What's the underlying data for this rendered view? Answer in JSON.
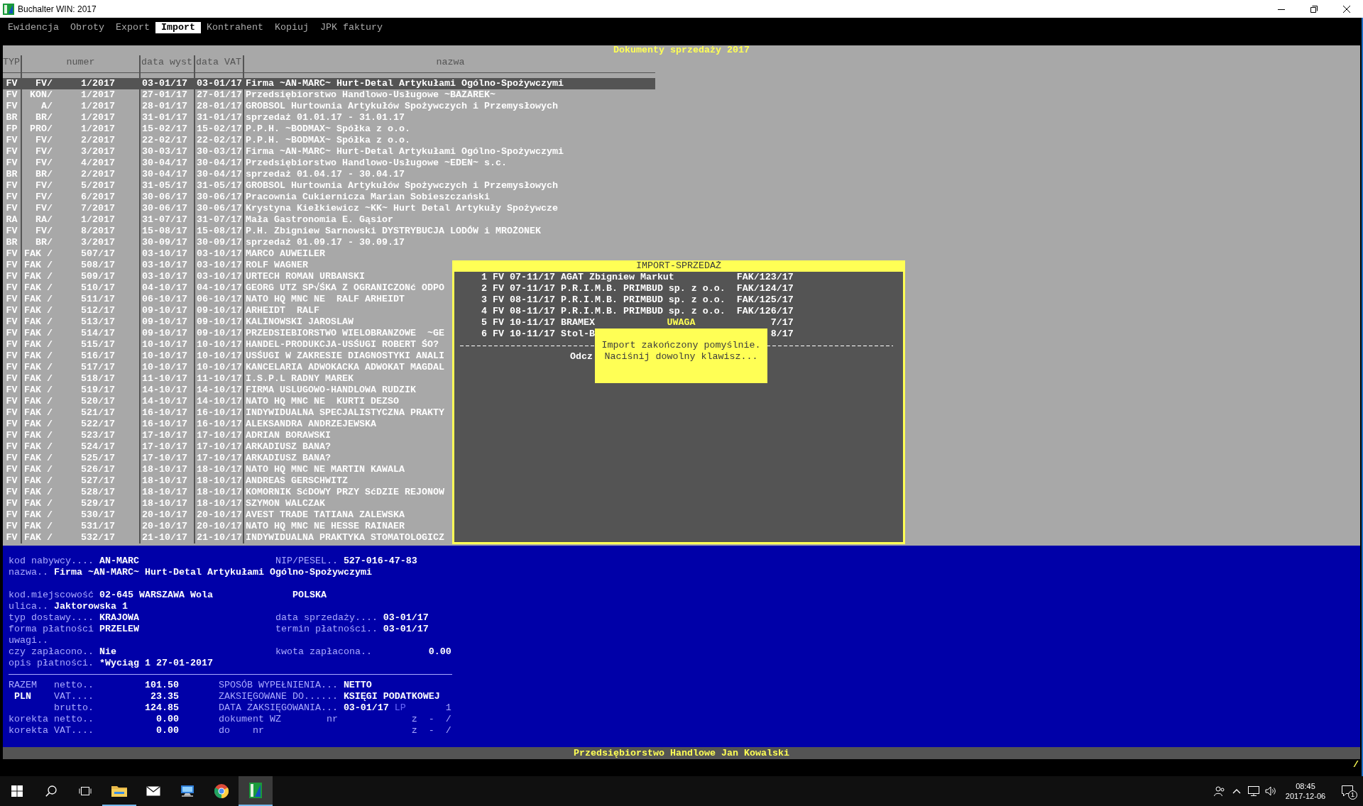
{
  "window": {
    "title": "Buchalter WIN: 2017"
  },
  "menu": [
    {
      "label": "Ewidencja",
      "selected": false
    },
    {
      "label": "Obroty",
      "selected": false
    },
    {
      "label": "Export",
      "selected": false
    },
    {
      "label": "Import",
      "selected": true
    },
    {
      "label": "Kontrahent",
      "selected": false
    },
    {
      "label": "Kopiuj",
      "selected": false
    },
    {
      "label": "JPK faktury",
      "selected": false
    }
  ],
  "list_title": "Dokumenty sprzedaży 2017",
  "table": {
    "columns": [
      "TYP",
      "numer",
      "data wyst",
      "data VAT",
      "nazwa"
    ],
    "rows": [
      {
        "typ": "FV",
        "series": "FV/",
        "number": "1/2017",
        "issued": "03-01/17",
        "vat_date": "03-01/17",
        "name": "Firma ~AN-MARC~ Hurt-Detal Artykułami Ogólno-Spożywczymi",
        "selected": true
      },
      {
        "typ": "FV",
        "series": "KON/",
        "number": "1/2017",
        "issued": "27-01/17",
        "vat_date": "27-01/17",
        "name": "Przedsiębiorstwo Handlowo-Usługowe ~BAZAREK~",
        "selected": false
      },
      {
        "typ": "FV",
        "series": "A/",
        "number": "1/2017",
        "issued": "28-01/17",
        "vat_date": "28-01/17",
        "name": "GROBSOL Hurtownia Artykułów Spożywczych i Przemysłowych",
        "selected": false
      },
      {
        "typ": "BR",
        "series": "BR/",
        "number": "1/2017",
        "issued": "31-01/17",
        "vat_date": "31-01/17",
        "name": "sprzedaż 01.01.17 - 31.01.17",
        "selected": false
      },
      {
        "typ": "FP",
        "series": "PRO/",
        "number": "1/2017",
        "issued": "15-02/17",
        "vat_date": "15-02/17",
        "name": "P.P.H. ~BODMAX~ Spółka z o.o.",
        "selected": false
      },
      {
        "typ": "FV",
        "series": "FV/",
        "number": "2/2017",
        "issued": "22-02/17",
        "vat_date": "22-02/17",
        "name": "P.P.H. ~BODMAX~ Spółka z o.o.",
        "selected": false
      },
      {
        "typ": "FV",
        "series": "FV/",
        "number": "3/2017",
        "issued": "30-03/17",
        "vat_date": "30-03/17",
        "name": "Firma ~AN-MARC~ Hurt-Detal Artykułami Ogólno-Spożywczymi",
        "selected": false
      },
      {
        "typ": "FV",
        "series": "FV/",
        "number": "4/2017",
        "issued": "30-04/17",
        "vat_date": "30-04/17",
        "name": "Przedsiębiorstwo Handlowo-Usługowe ~EDEN~ s.c.",
        "selected": false
      },
      {
        "typ": "BR",
        "series": "BR/",
        "number": "2/2017",
        "issued": "30-04/17",
        "vat_date": "30-04/17",
        "name": "sprzedaż 01.04.17 - 30.04.17",
        "selected": false
      },
      {
        "typ": "FV",
        "series": "FV/",
        "number": "5/2017",
        "issued": "31-05/17",
        "vat_date": "31-05/17",
        "name": "GROBSOL Hurtownia Artykułów Spożywczych i Przemysłowych",
        "selected": false
      },
      {
        "typ": "FV",
        "series": "FV/",
        "number": "6/2017",
        "issued": "30-06/17",
        "vat_date": "30-06/17",
        "name": "Pracownia Cukiernicza Marian Sobieszczański",
        "selected": false
      },
      {
        "typ": "FV",
        "series": "FV/",
        "number": "7/2017",
        "issued": "30-06/17",
        "vat_date": "30-06/17",
        "name": "Krystyna Kiełkiewicz ~KK~ Hurt Detal Artykuły Spożywcze",
        "selected": false
      },
      {
        "typ": "RA",
        "series": "RA/",
        "number": "1/2017",
        "issued": "31-07/17",
        "vat_date": "31-07/17",
        "name": "Mała Gastronomia E. Gąsior",
        "selected": false
      },
      {
        "typ": "FV",
        "series": "FV/",
        "number": "8/2017",
        "issued": "15-08/17",
        "vat_date": "15-08/17",
        "name": "P.H. Zbigniew Sarnowski DYSTRYBUCJA LODÓW i MROŻONEK",
        "selected": false
      },
      {
        "typ": "BR",
        "series": "BR/",
        "number": "3/2017",
        "issued": "30-09/17",
        "vat_date": "30-09/17",
        "name": "sprzedaż 01.09.17 - 30.09.17",
        "selected": false
      },
      {
        "typ": "FV",
        "series": "FAK /",
        "number": "507/17",
        "issued": "03-10/17",
        "vat_date": "03-10/17",
        "name": "MARCO AUWEILER",
        "selected": false
      },
      {
        "typ": "FV",
        "series": "FAK /",
        "number": "508/17",
        "issued": "03-10/17",
        "vat_date": "03-10/17",
        "name": "ROLF WAGNER",
        "selected": false
      },
      {
        "typ": "FV",
        "series": "FAK /",
        "number": "509/17",
        "issued": "03-10/17",
        "vat_date": "03-10/17",
        "name": "URTECH ROMAN URBANSKI",
        "selected": false
      },
      {
        "typ": "FV",
        "series": "FAK /",
        "number": "510/17",
        "issued": "04-10/17",
        "vat_date": "04-10/17",
        "name": "GEORG UTZ SP√ŚKA Z OGRANICZONć ODPO",
        "selected": false
      },
      {
        "typ": "FV",
        "series": "FAK /",
        "number": "511/17",
        "issued": "06-10/17",
        "vat_date": "06-10/17",
        "name": "NATO HQ MNC NE  RALF ARHEIDT",
        "selected": false
      },
      {
        "typ": "FV",
        "series": "FAK /",
        "number": "512/17",
        "issued": "09-10/17",
        "vat_date": "09-10/17",
        "name": "ARHEIDT  RALF",
        "selected": false
      },
      {
        "typ": "FV",
        "series": "FAK /",
        "number": "513/17",
        "issued": "09-10/17",
        "vat_date": "09-10/17",
        "name": "KALINOWSKI JAROSLAW",
        "selected": false
      },
      {
        "typ": "FV",
        "series": "FAK /",
        "number": "514/17",
        "issued": "09-10/17",
        "vat_date": "09-10/17",
        "name": "PRZEDSIEBIORSTWO WIELOBRANZOWE  ~GE",
        "selected": false
      },
      {
        "typ": "FV",
        "series": "FAK /",
        "number": "515/17",
        "issued": "10-10/17",
        "vat_date": "10-10/17",
        "name": "HANDEL-PRODUKCJA-USŚUGI ROBERT ŚO?",
        "selected": false
      },
      {
        "typ": "FV",
        "series": "FAK /",
        "number": "516/17",
        "issued": "10-10/17",
        "vat_date": "10-10/17",
        "name": "USŚUGI W ZAKRESIE DIAGNOSTYKI ANALI",
        "selected": false
      },
      {
        "typ": "FV",
        "series": "FAK /",
        "number": "517/17",
        "issued": "10-10/17",
        "vat_date": "10-10/17",
        "name": "KANCELARIA ADWOKACKA ADWOKAT MAGDAL",
        "selected": false
      },
      {
        "typ": "FV",
        "series": "FAK /",
        "number": "518/17",
        "issued": "11-10/17",
        "vat_date": "11-10/17",
        "name": "I.S.P.L RADNY MAREK",
        "selected": false
      },
      {
        "typ": "FV",
        "series": "FAK /",
        "number": "519/17",
        "issued": "14-10/17",
        "vat_date": "14-10/17",
        "name": "FIRMA USLUGOWO-HANDLOWA RUDZIK",
        "selected": false
      },
      {
        "typ": "FV",
        "series": "FAK /",
        "number": "520/17",
        "issued": "14-10/17",
        "vat_date": "14-10/17",
        "name": "NATO HQ MNC NE  KURTI DEZSO",
        "selected": false
      },
      {
        "typ": "FV",
        "series": "FAK /",
        "number": "521/17",
        "issued": "16-10/17",
        "vat_date": "16-10/17",
        "name": "INDYWIDUALNA SPECJALISTYCZNA PRAKTY",
        "selected": false
      },
      {
        "typ": "FV",
        "series": "FAK /",
        "number": "522/17",
        "issued": "16-10/17",
        "vat_date": "16-10/17",
        "name": "ALEKSANDRA ANDRZEJEWSKA",
        "selected": false
      },
      {
        "typ": "FV",
        "series": "FAK /",
        "number": "523/17",
        "issued": "17-10/17",
        "vat_date": "17-10/17",
        "name": "ADRIAN BORAWSKI",
        "selected": false
      },
      {
        "typ": "FV",
        "series": "FAK /",
        "number": "524/17",
        "issued": "17-10/17",
        "vat_date": "17-10/17",
        "name": "ARKADIUSZ BANA?",
        "selected": false
      },
      {
        "typ": "FV",
        "series": "FAK /",
        "number": "525/17",
        "issued": "17-10/17",
        "vat_date": "17-10/17",
        "name": "ARKADIUSZ BANA?",
        "selected": false
      },
      {
        "typ": "FV",
        "series": "FAK /",
        "number": "526/17",
        "issued": "18-10/17",
        "vat_date": "18-10/17",
        "name": "NATO HQ MNC NE MARTIN KAWALA",
        "selected": false
      },
      {
        "typ": "FV",
        "series": "FAK /",
        "number": "527/17",
        "issued": "18-10/17",
        "vat_date": "18-10/17",
        "name": "ANDREAS GERSCHWITZ",
        "selected": false
      },
      {
        "typ": "FV",
        "series": "FAK /",
        "number": "528/17",
        "issued": "18-10/17",
        "vat_date": "18-10/17",
        "name": "KOMORNIK SćDOWY PRZY SćDZIE REJONOW",
        "selected": false
      },
      {
        "typ": "FV",
        "series": "FAK /",
        "number": "529/17",
        "issued": "18-10/17",
        "vat_date": "18-10/17",
        "name": "SZYMON WALCZAK",
        "selected": false
      },
      {
        "typ": "FV",
        "series": "FAK /",
        "number": "530/17",
        "issued": "20-10/17",
        "vat_date": "20-10/17",
        "name": "AVEST TRADE TATIANA ZALEWSKA",
        "selected": false
      },
      {
        "typ": "FV",
        "series": "FAK /",
        "number": "531/17",
        "issued": "20-10/17",
        "vat_date": "20-10/17",
        "name": "NATO HQ MNC NE HESSE RAINAER",
        "selected": false
      },
      {
        "typ": "FV",
        "series": "FAK /",
        "number": "532/17",
        "issued": "21-10/17",
        "vat_date": "21-10/17",
        "name": "INDYWIDUALNA PRAKTYKA STOMATOLOGICZ",
        "selected": false
      }
    ]
  },
  "import_dialog": {
    "title": "IMPORT-SPRZEDAŻ",
    "items": [
      {
        "no": "1",
        "typ": "FV",
        "date": "07-11/17",
        "name": "AGAT Zbigniew Markut",
        "number": "FAK/123/17"
      },
      {
        "no": "2",
        "typ": "FV",
        "date": "07-11/17",
        "name": "P.R.I.M.B. PRIMBUD sp. z o.o.",
        "number": "FAK/124/17"
      },
      {
        "no": "3",
        "typ": "FV",
        "date": "08-11/17",
        "name": "P.R.I.M.B. PRIMBUD sp. z o.o.",
        "number": "FAK/125/17"
      },
      {
        "no": "4",
        "typ": "FV",
        "date": "08-11/17",
        "name": "P.R.I.M.B. PRIMBUD sp. z o.o.",
        "number": "FAK/126/17"
      },
      {
        "no": "5",
        "typ": "FV",
        "date": "10-11/17",
        "name": "BRAMEX",
        "number": "7/17"
      },
      {
        "no": "6",
        "typ": "FV",
        "date": "10-11/17",
        "name": "Stol-B",
        "number": "8/17"
      }
    ],
    "footer": "Odcz",
    "alert": {
      "title": "UWAGA",
      "lines": [
        "Import zakończony pomyślnie.",
        "Naciśnij dowolny klawisz..."
      ]
    }
  },
  "customer": {
    "header": [
      {
        "left": {
          "label": "kod nabywcy....",
          "value": "AN-MARC"
        },
        "right": {
          "kind": "text",
          "label": "NIP/PESEL..",
          "value": "527-016-47-83"
        }
      },
      {
        "left": {
          "label": "nazwa..",
          "value": "Firma ~AN-MARC~ Hurt-Detal Artykułami Ogólno-Spożywczymi"
        }
      }
    ],
    "details": [
      {
        "left": {
          "label": "kod.miejscowość",
          "value": "02-645 WARSZAWA Wola"
        },
        "right": {
          "kind": "text",
          "value": "POLSKA"
        }
      },
      {
        "left": {
          "label": "ulica..",
          "value": "Jaktorowska 1"
        }
      },
      {
        "left": {
          "label": "typ dostawy....",
          "value": "KRAJOWA"
        },
        "right": {
          "kind": "text",
          "label": "data sprzedaży....",
          "value": "03-01/17"
        }
      },
      {
        "left": {
          "label": "forma płatności",
          "value": "PRZELEW"
        },
        "right": {
          "kind": "text",
          "label": "termin płatności..",
          "value": "03-01/17"
        }
      },
      {
        "left": {
          "label": "uwagi.."
        }
      },
      {
        "left": {
          "label": "czy zapłacono..",
          "value": "Nie"
        },
        "right": {
          "kind": "amount",
          "label": "kwota zapłacona..",
          "value": "0.00"
        }
      },
      {
        "left": {
          "label": "opis płatności.",
          "value": "*Wyciąg 1 27-01-2017"
        }
      }
    ]
  },
  "summary": [
    {
      "kind": "total",
      "tag": {
        "text": "RAZEM",
        "kind": "label"
      },
      "label": "netto..",
      "value": "101.50",
      "right": [
        {
          "kind": "label",
          "text": "SPOSÓB WYPEŁNIENIA..."
        },
        {
          "kind": "value",
          "text": "NETTO"
        }
      ]
    },
    {
      "kind": "total",
      "tag": {
        "text": "PLN",
        "kind": "value"
      },
      "label": "VAT....",
      "value": "23.35",
      "right": [
        {
          "kind": "label",
          "text": "ZAKSIĘGOWANE DO......"
        },
        {
          "kind": "value",
          "text": "KSIĘGI PODATKOWEJ"
        }
      ]
    },
    {
      "kind": "total",
      "label": "brutto.",
      "value": "124.85",
      "right": [
        {
          "kind": "label",
          "text": "DATA ZAKSIĘGOWANIA..."
        },
        {
          "kind": "value",
          "text": "03-01/17"
        },
        {
          "kind": "mark",
          "text": "LP"
        },
        {
          "kind": "end",
          "text": "1"
        }
      ]
    },
    {
      "kind": "correction",
      "label": "korekta netto..",
      "value": "0.00",
      "right": [
        {
          "kind": "label",
          "text": "dokument WZ        nr"
        },
        {
          "kind": "end",
          "text": "z  -  /"
        }
      ]
    },
    {
      "kind": "correction",
      "label": "korekta VAT....",
      "value": "0.00",
      "right": [
        {
          "kind": "label",
          "text": "do    nr"
        },
        {
          "kind": "end",
          "text": "z  -  /"
        }
      ]
    }
  ],
  "status_bar": {
    "company": "Przedsiębiorstwo Handlowe Jan Kowalski",
    "indicator": "/"
  },
  "taskbar": {
    "system_buttons": [
      {
        "kind": "start"
      },
      {
        "kind": "search"
      },
      {
        "kind": "task_view"
      }
    ],
    "apps": [
      {
        "kind": "explorer",
        "running": true,
        "active": false
      },
      {
        "kind": "mail",
        "running": false,
        "active": false
      },
      {
        "kind": "remote",
        "running": false,
        "active": false
      },
      {
        "kind": "chrome",
        "running": false,
        "active": false
      },
      {
        "kind": "buchalter",
        "running": true,
        "active": true
      }
    ],
    "tray": [
      {
        "kind": "people"
      },
      {
        "kind": "chevron"
      },
      {
        "kind": "network"
      },
      {
        "kind": "volume"
      }
    ],
    "clock": {
      "time": "08:45",
      "date": "2017-12-06"
    },
    "notification_count": "1"
  }
}
